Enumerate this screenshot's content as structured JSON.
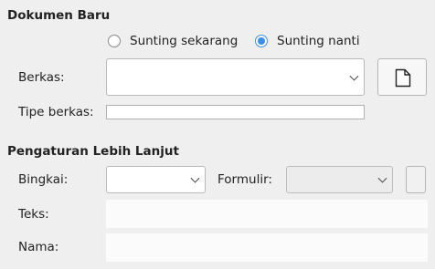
{
  "new_document": {
    "title": "Dokumen Baru",
    "radio_edit_now": "Sunting sekarang",
    "radio_edit_later": "Sunting nanti",
    "file_label": "Berkas:",
    "file_type_label": "Tipe berkas:",
    "file_value": "",
    "file_type_value": ""
  },
  "advanced": {
    "title": "Pengaturan Lebih Lanjut",
    "frame_label": "Bingkai:",
    "form_label": "Formulir:",
    "text_label": "Teks:",
    "name_label": "Nama:",
    "text_value": "",
    "name_value": ""
  },
  "icons": {
    "new_document": "document-icon",
    "dropdown": "chevron-down-icon"
  }
}
